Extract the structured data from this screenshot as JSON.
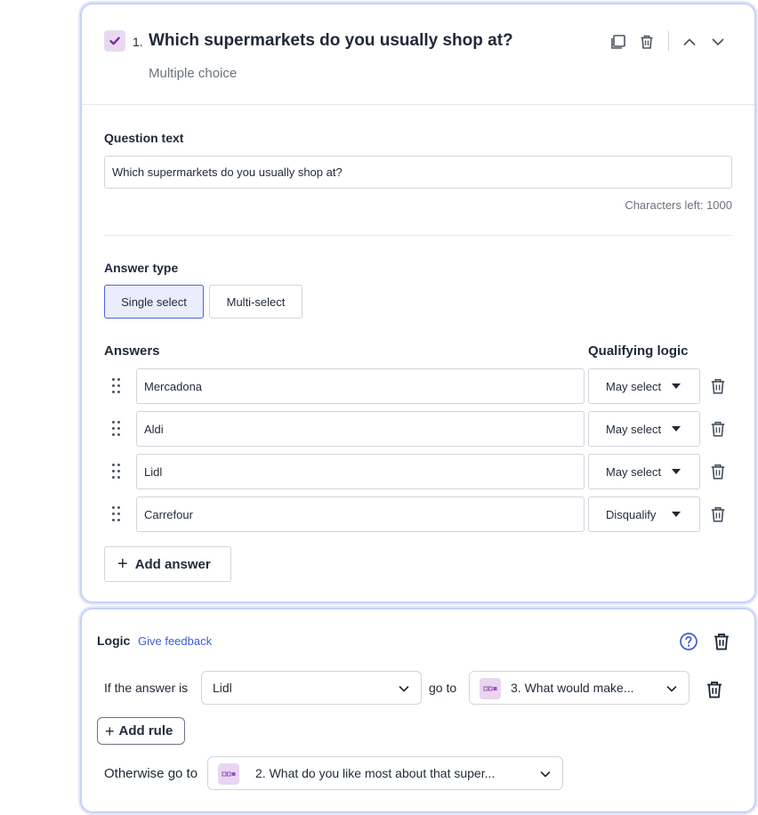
{
  "question": {
    "number": "1.",
    "title": "Which supermarkets do you usually shop at?",
    "type_label": "Multiple choice",
    "question_text_label": "Question text",
    "question_text_value": "Which supermarkets do you usually shop at?",
    "characters_left": "Characters left: 1000",
    "answer_type_label": "Answer type",
    "answer_types": [
      {
        "label": "Single select",
        "selected": true
      },
      {
        "label": "Multi-select",
        "selected": false
      }
    ],
    "answers_label": "Answers",
    "qualifying_logic_label": "Qualifying logic",
    "answers": [
      {
        "text": "Mercadona",
        "logic": "May select"
      },
      {
        "text": "Aldi",
        "logic": "May select"
      },
      {
        "text": "Lidl",
        "logic": "May select"
      },
      {
        "text": "Carrefour",
        "logic": "Disqualify"
      }
    ],
    "add_answer_label": "Add answer"
  },
  "logic": {
    "title": "Logic",
    "feedback_link": "Give feedback",
    "if_label": "If the answer is",
    "if_value": "Lidl",
    "goto_label": "go to",
    "goto_value": "3. What would make...",
    "add_rule_label": "Add rule",
    "otherwise_label": "Otherwise go to",
    "otherwise_value": "2. What do you like most about that super..."
  },
  "colors": {
    "accent": "#4966e0",
    "link": "#3b5bdb",
    "checkbox_bg": "#ead8f1",
    "checkbox_mark": "#7b2d9e",
    "card_border": "#c7d2f5"
  },
  "icons": {
    "checkbox": "check-icon",
    "duplicate": "copy-icon",
    "delete": "trash-icon",
    "move_up": "chevron-up-icon",
    "move_down": "chevron-down-icon",
    "drag": "drag-handle-icon",
    "help": "help-circle-icon",
    "question_ref": "question-node-icon"
  }
}
